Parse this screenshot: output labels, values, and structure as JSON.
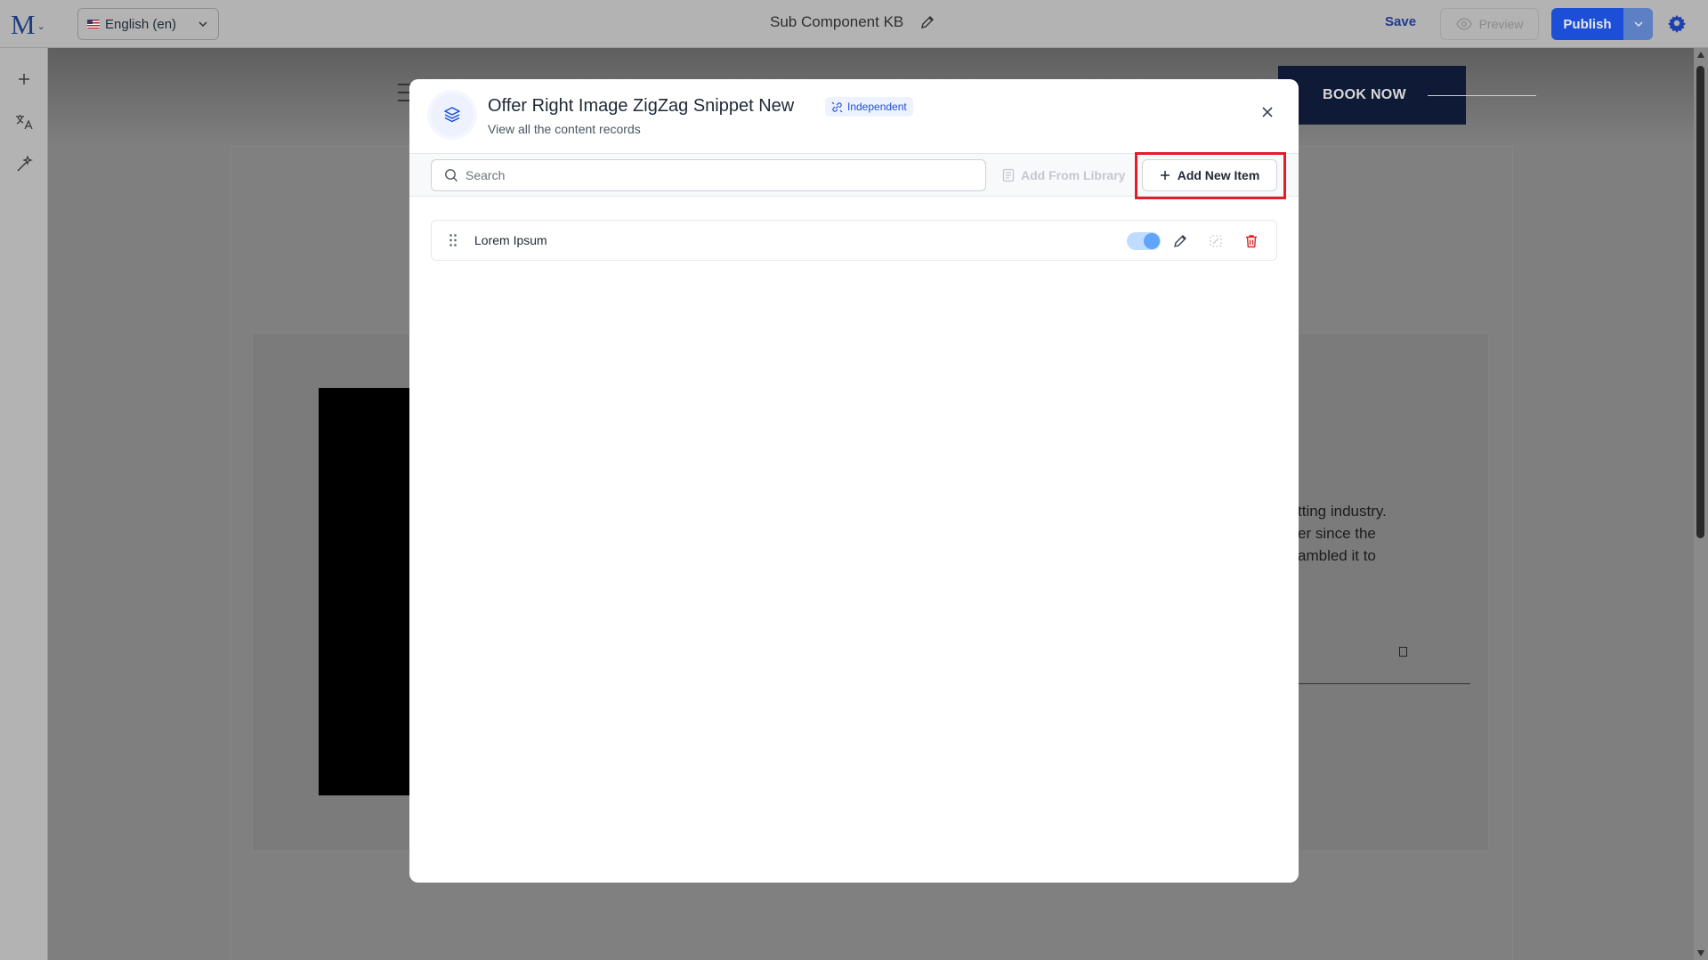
{
  "topbar": {
    "logo_letter": "M",
    "language": "English (en)",
    "page_name": "Sub Component KB",
    "save_label": "Save",
    "preview_label": "Preview",
    "publish_label": "Publish"
  },
  "canvas": {
    "book_now": "BOOK NOW",
    "text_lines": [
      "tting industry.",
      "er since the",
      "ambled it to"
    ]
  },
  "modal": {
    "title": "Offer Right Image ZigZag Snippet New",
    "badge": "Independent",
    "subtitle": "View all the content records",
    "search_placeholder": "Search",
    "add_from_library": "Add From Library",
    "add_new_item": "Add New Item",
    "items": [
      {
        "label": "Lorem Ipsum",
        "enabled": true
      }
    ]
  },
  "colors": {
    "primary": "#1d4ed8",
    "highlight": "#e11d2a",
    "delete": "#dc2626"
  }
}
